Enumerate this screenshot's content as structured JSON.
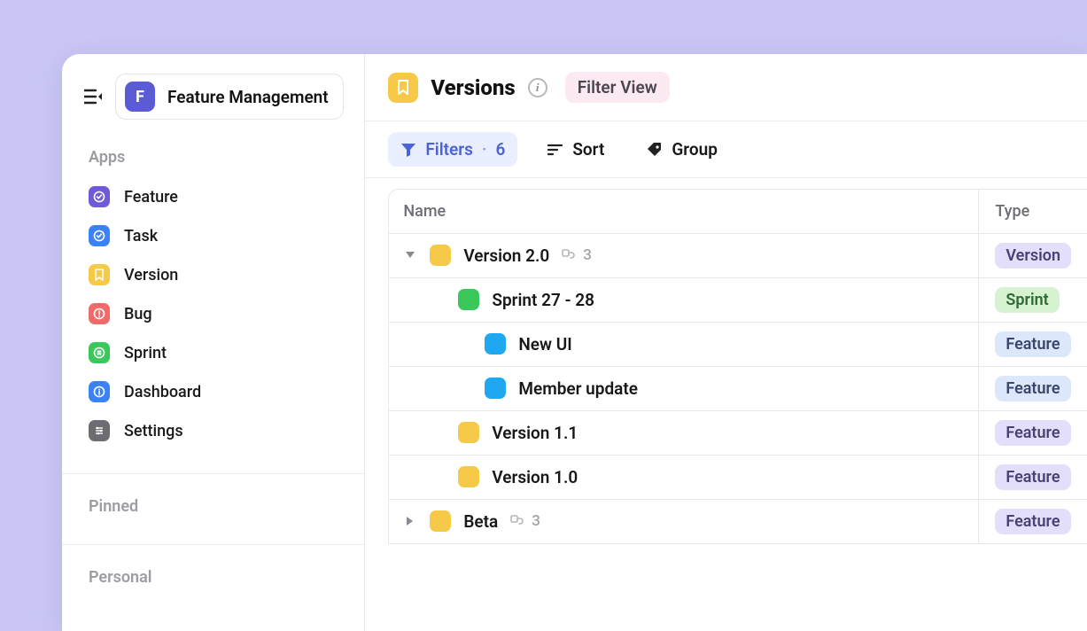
{
  "workspace": {
    "icon_letter": "F",
    "name": "Feature Management"
  },
  "sidebar": {
    "sections": {
      "apps": "Apps",
      "pinned": "Pinned",
      "personal": "Personal"
    },
    "items": [
      {
        "label": "Feature",
        "color": "#6f5bd8",
        "icon": "check-circle"
      },
      {
        "label": "Task",
        "color": "#3b82f6",
        "icon": "check-circle"
      },
      {
        "label": "Version",
        "color": "#f7c948",
        "icon": "bookmark"
      },
      {
        "label": "Bug",
        "color": "#f06a6a",
        "icon": "alert"
      },
      {
        "label": "Sprint",
        "color": "#3ac85a",
        "icon": "list"
      },
      {
        "label": "Dashboard",
        "color": "#3b82f6",
        "icon": "info"
      },
      {
        "label": "Settings",
        "color": "#6c6c73",
        "icon": "sliders"
      }
    ]
  },
  "header": {
    "title": "Versions",
    "filter_view_label": "Filter View"
  },
  "toolbar": {
    "filters_label": "Filters",
    "filters_count": "6",
    "sort_label": "Sort",
    "group_label": "Group"
  },
  "table": {
    "columns": {
      "name": "Name",
      "type": "Type"
    },
    "rows": [
      {
        "indent": 1,
        "expand": "open",
        "color": "amber",
        "label": "Version 2.0",
        "subcount": "3",
        "type": "Version",
        "type_style": "version"
      },
      {
        "indent": 2,
        "expand": "none",
        "color": "green",
        "label": "Sprint 27 - 28",
        "subcount": "",
        "type": "Sprint",
        "type_style": "sprint"
      },
      {
        "indent": 3,
        "expand": "none",
        "color": "blue",
        "label": "New UI",
        "subcount": "",
        "type": "Feature",
        "type_style": "feature"
      },
      {
        "indent": 3,
        "expand": "none",
        "color": "blue",
        "label": "Member update",
        "subcount": "",
        "type": "Feature",
        "type_style": "feature"
      },
      {
        "indent": 2,
        "expand": "none",
        "color": "amber",
        "label": "Version 1.1",
        "subcount": "",
        "type": "Feature",
        "type_style": "version"
      },
      {
        "indent": 2,
        "expand": "none",
        "color": "amber",
        "label": "Version 1.0",
        "subcount": "",
        "type": "Feature",
        "type_style": "version"
      },
      {
        "indent": 1,
        "expand": "closed",
        "color": "amber",
        "label": "Beta",
        "subcount": "3",
        "type": "Feature",
        "type_style": "version"
      }
    ]
  },
  "icons": {
    "check-circle": "◎",
    "bookmark": "◻",
    "alert": "!",
    "list": "≡",
    "info": "i",
    "sliders": "≡"
  }
}
